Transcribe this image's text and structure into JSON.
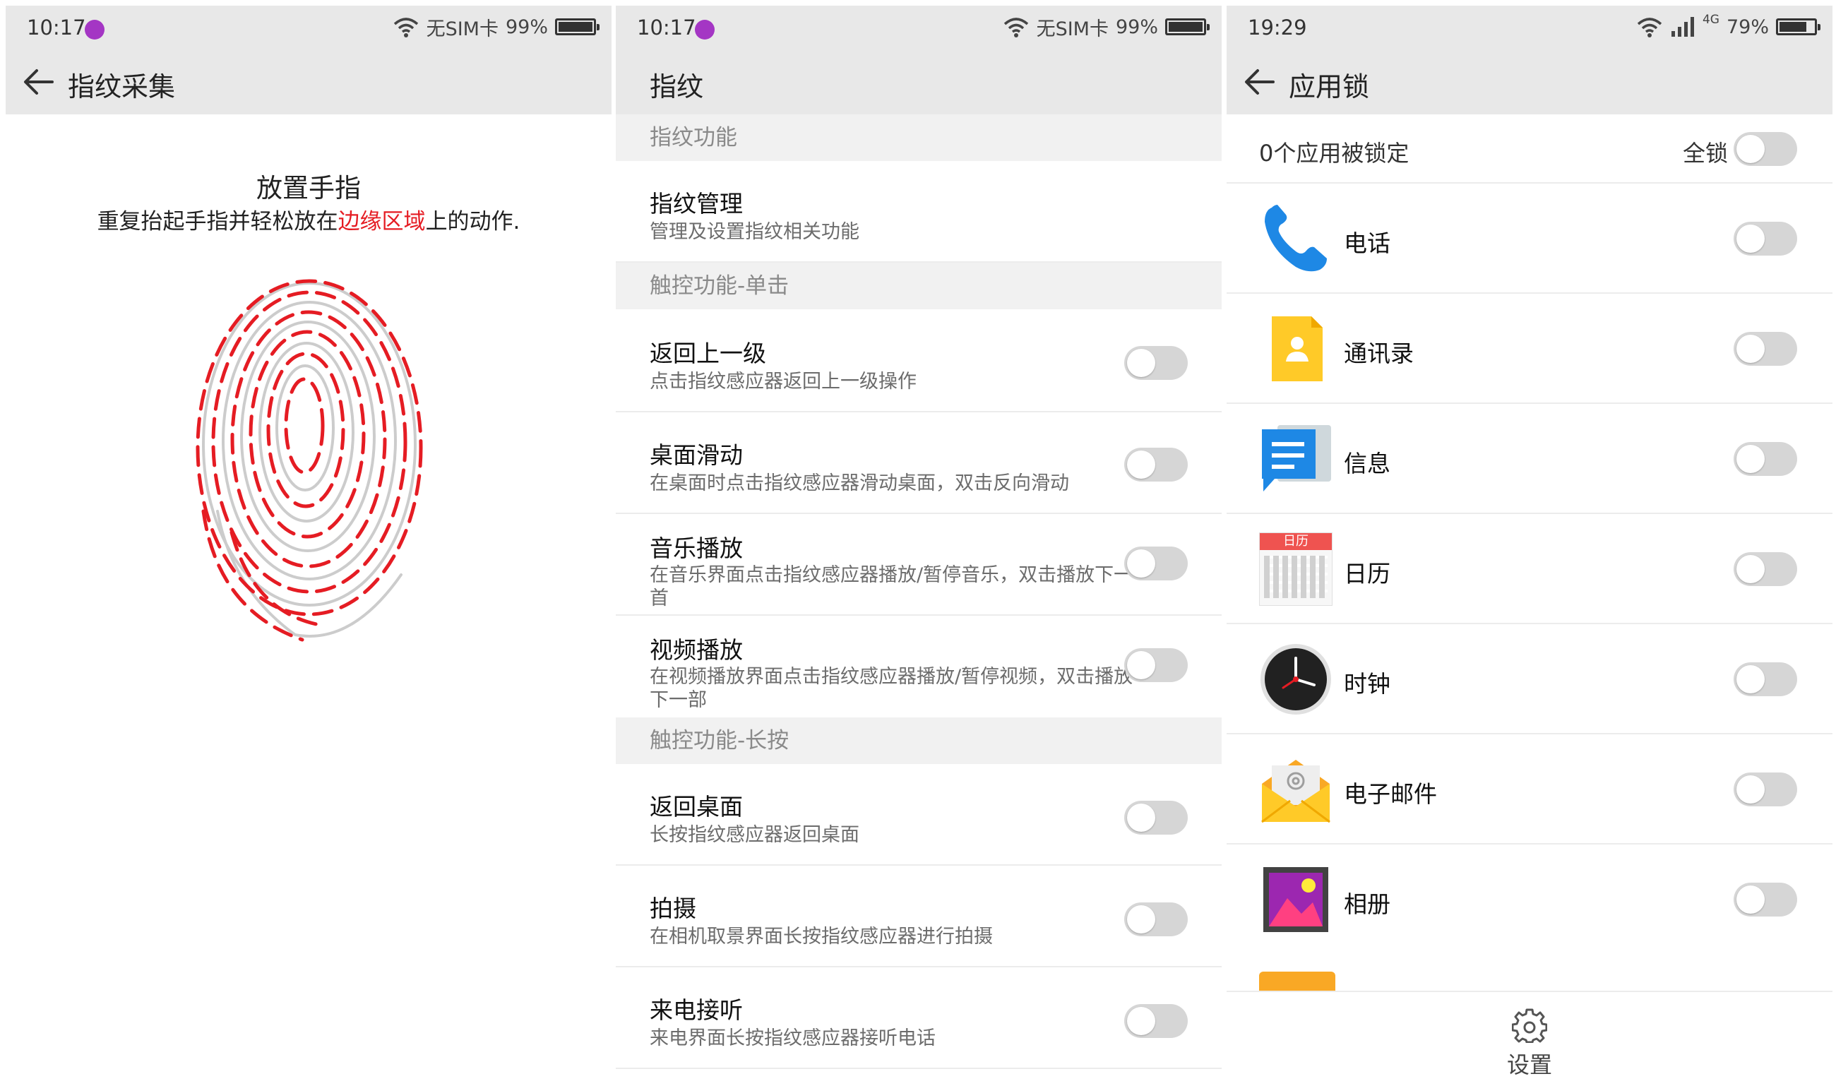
{
  "panels": {
    "capture": {
      "status": {
        "time": "10:17",
        "sim": "无SIM卡",
        "battery": "99%",
        "battery_level": 0.99
      },
      "title": "指纹采集",
      "heading": "放置手指",
      "instruction_pre": "重复抬起手指并轻松放在",
      "instruction_highlight": "边缘区域",
      "instruction_post": "上的动作.",
      "highlight_color": "#e51c23"
    },
    "fingerprint": {
      "status": {
        "time": "10:17",
        "sim": "无SIM卡",
        "battery": "99%",
        "battery_level": 0.99
      },
      "title": "指纹",
      "sections": [
        {
          "header": "指纹功能"
        },
        {
          "header": "触控功能-单击"
        },
        {
          "header": "触控功能-长按"
        }
      ],
      "items": [
        {
          "title": "指纹管理",
          "desc": "管理及设置指纹相关功能",
          "toggle": false,
          "has_toggle": false
        },
        {
          "title": "返回上一级",
          "desc": "点击指纹感应器返回上一级操作",
          "toggle": false,
          "has_toggle": true
        },
        {
          "title": "桌面滑动",
          "desc": "在桌面时点击指纹感应器滑动桌面，双击反向滑动",
          "toggle": false,
          "has_toggle": true
        },
        {
          "title": "音乐播放",
          "desc": "在音乐界面点击指纹感应器播放/暂停音乐，双击播放下一首",
          "toggle": false,
          "has_toggle": true
        },
        {
          "title": "视频播放",
          "desc": "在视频播放界面点击指纹感应器播放/暂停视频，双击播放下一部",
          "toggle": false,
          "has_toggle": true
        },
        {
          "title": "返回桌面",
          "desc": "长按指纹感应器返回桌面",
          "toggle": false,
          "has_toggle": true
        },
        {
          "title": "拍摄",
          "desc": "在相机取景界面长按指纹感应器进行拍摄",
          "toggle": false,
          "has_toggle": true
        },
        {
          "title": "来电接听",
          "desc": "来电界面长按指纹感应器接听电话",
          "toggle": false,
          "has_toggle": true
        }
      ]
    },
    "applock": {
      "status": {
        "time": "19:29",
        "network": "4G",
        "battery": "79%",
        "battery_level": 0.79
      },
      "title": "应用锁",
      "locked_count": "0个应用被锁定",
      "lock_all": "全锁",
      "apps": [
        {
          "name": "电话",
          "icon": "phone-icon",
          "locked": false
        },
        {
          "name": "通讯录",
          "icon": "contacts-icon",
          "locked": false
        },
        {
          "name": "信息",
          "icon": "messages-icon",
          "locked": false
        },
        {
          "name": "日历",
          "icon": "calendar-icon",
          "icon_text": "日历",
          "locked": false
        },
        {
          "name": "时钟",
          "icon": "clock-icon",
          "locked": false
        },
        {
          "name": "电子邮件",
          "icon": "email-icon",
          "locked": false
        },
        {
          "name": "相册",
          "icon": "gallery-icon",
          "locked": false
        }
      ],
      "settings_label": "设置"
    }
  },
  "colors": {
    "bar": "#e8e8e8",
    "section": "#f1f1f1",
    "toggle_off": "#d6d6d6",
    "accent_red": "#e51c23"
  }
}
